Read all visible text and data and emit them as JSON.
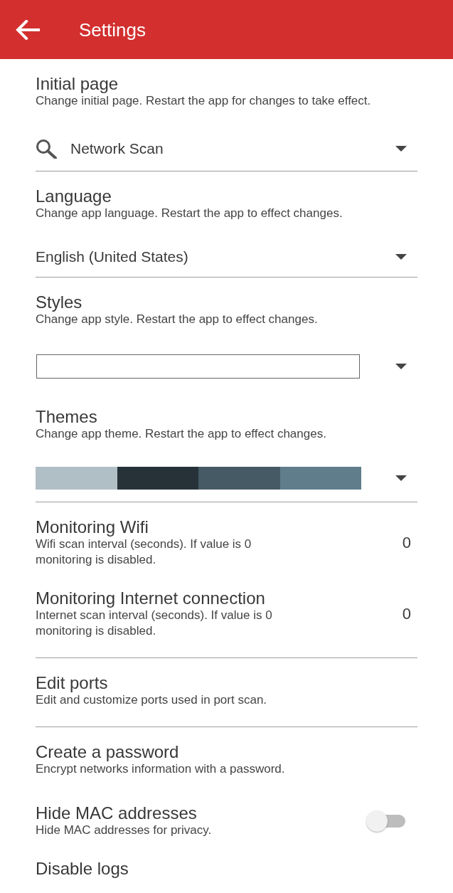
{
  "app_bar": {
    "title": "Settings"
  },
  "settings": [
    {
      "kind": "page_dropdown",
      "title": "Initial page",
      "description": "Change initial page. Restart the app for changes to take effect.",
      "value": "Network Scan",
      "divider": true
    },
    {
      "kind": "dropdown",
      "title": "Language",
      "description": "Change app language. Restart the app to effect changes.",
      "value": "English (United States)",
      "divider": true
    },
    {
      "kind": "style_dropdown",
      "title": "Styles",
      "description": "Change app style. Restart the app to effect changes.",
      "divider": false
    },
    {
      "kind": "theme_dropdown",
      "title": "Themes",
      "description": "Change app theme. Restart the app to effect changes.",
      "swatches": [
        {
          "color": "#b0bec5"
        },
        {
          "color": "#263238"
        },
        {
          "color": "#455a64"
        },
        {
          "color": "#607d8b"
        }
      ],
      "divider": true
    },
    {
      "kind": "number",
      "title": "Monitoring Wifi",
      "description": "Wifi scan interval (seconds). If value is 0 monitoring is disabled.",
      "value": "0",
      "divider": false
    },
    {
      "kind": "number",
      "title": "Monitoring Internet connection",
      "description": "Internet scan interval (seconds). If value is 0 monitoring is disabled.",
      "value": "0",
      "divider": true
    },
    {
      "kind": "link",
      "title": "Edit ports",
      "description": "Edit and customize ports used in port scan.",
      "divider": true
    },
    {
      "kind": "link",
      "title": "Create a password",
      "description": "Encrypt networks information with a password.",
      "divider": false
    },
    {
      "kind": "switch",
      "title": "Hide MAC addresses",
      "description": "Hide MAC addresses for privacy.",
      "on": false,
      "divider": false
    },
    {
      "kind": "link",
      "title": "Disable logs",
      "divider": false
    }
  ]
}
